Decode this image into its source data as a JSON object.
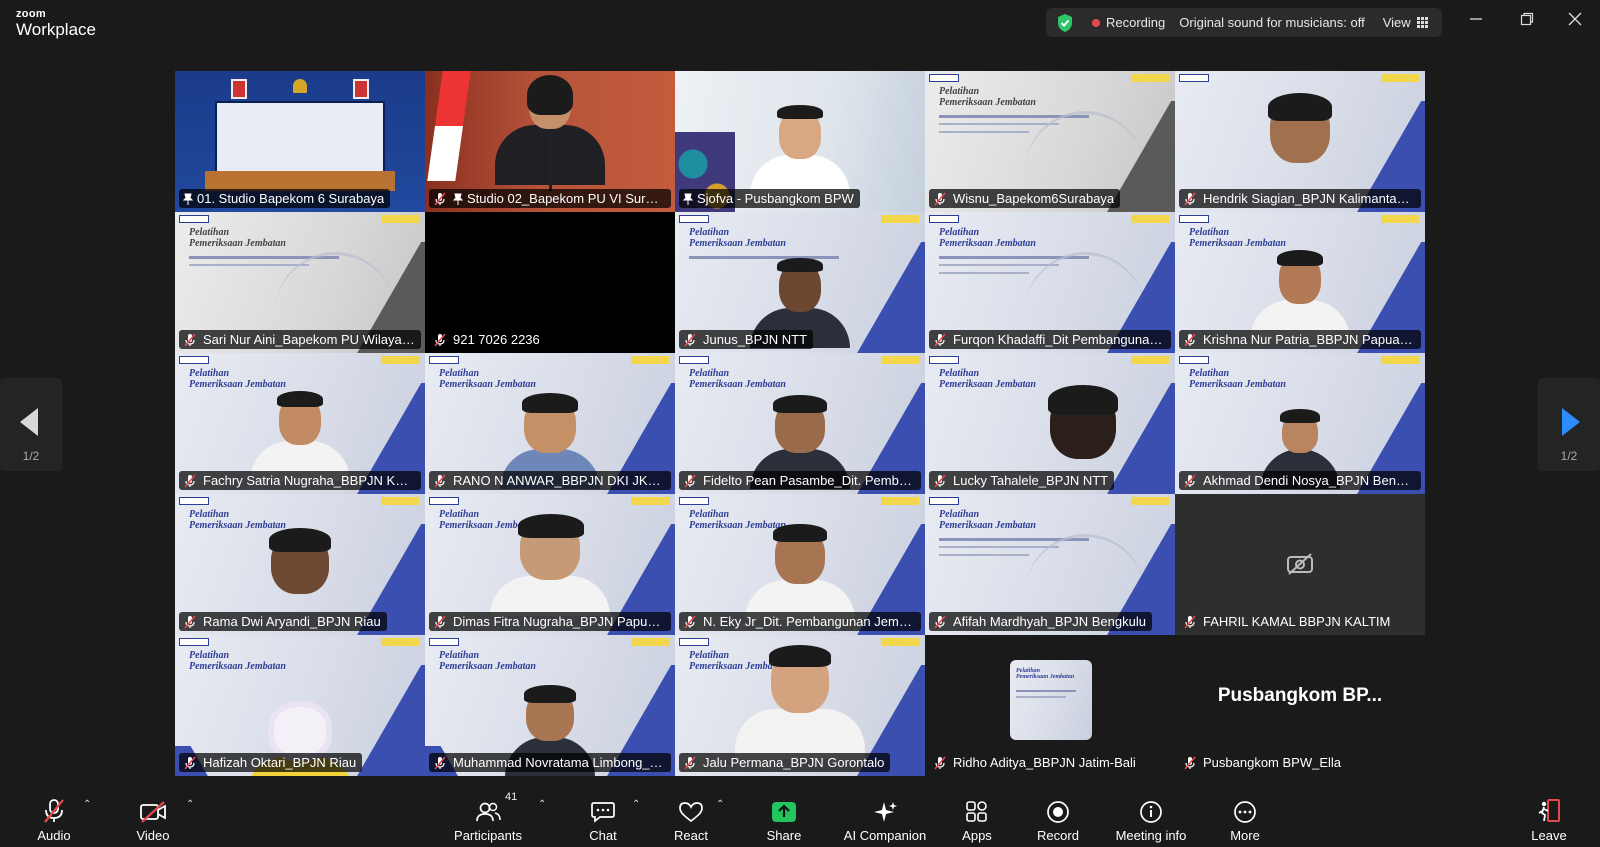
{
  "app": {
    "logo_top": "zoom",
    "logo_bottom": "Workplace"
  },
  "status": {
    "recording_label": "Recording",
    "original_sound": "Original sound for musicians: off",
    "view_label": "View"
  },
  "pager": {
    "left_page": "1/2",
    "right_page": "1/2"
  },
  "tiles": [
    {
      "name": "01. Studio Bapekom 6 Surabaya"
    },
    {
      "name": "Studio 02_Bapekom PU VI Suraba..."
    },
    {
      "name": "Sjofva - Pusbangkom BPW"
    },
    {
      "name": "Wisnu_Bapekom6Surabaya"
    },
    {
      "name": "Hendrik Siagian_BPJN Kalimantan Ba..."
    },
    {
      "name": "Sari Nur Aini_Bapekom PU Wilayah V..."
    },
    {
      "name": "921 7026 2236"
    },
    {
      "name": "Junus_BPJN NTT"
    },
    {
      "name": "Furqon Khadaffi_Dit Pembangunan J..."
    },
    {
      "name": "Krishna Nur Patria_BBPJN Papua Bara..."
    },
    {
      "name": "Fachry Satria Nugraha_BBPJN Kaltim"
    },
    {
      "name": "RANO N ANWAR_BBPJN DKI JKT-JAB..."
    },
    {
      "name": "Fidelto Pean Pasambe_Dit. Pembangu..."
    },
    {
      "name": "Lucky  Tahalele_BPJN NTT"
    },
    {
      "name": "Akhmad Dendi Nosya_BPJN Bengkulu"
    },
    {
      "name": "Rama Dwi Aryandi_BPJN Riau"
    },
    {
      "name": "Dimas Fitra Nugraha_BPJN Papua Sel..."
    },
    {
      "name": "N. Eky Jr_Dit. Pembangunan Jembatan"
    },
    {
      "name": "Afifah Mardhyah_BPJN Bengkulu"
    },
    {
      "name": "FAHRIL KAMAL BBPJN KALTIM"
    },
    {
      "name": "Hafizah Oktari_BPJN Riau"
    },
    {
      "name": "Muhammad Novratama Limbong_BP..."
    },
    {
      "name": "Jalu Permana_BPJN Gorontalo"
    },
    {
      "name": "Ridho Aditya_BBPJN Jatim-Bali"
    },
    {
      "name": "Pusbangkom BPW_Ella",
      "big_label": "Pusbangkom  BP..."
    }
  ],
  "slide": {
    "title_line1": "Pelatihan",
    "title_line2": "Pemeriksaan Jembatan"
  },
  "toolbar": {
    "audio": "Audio",
    "video": "Video",
    "participants": "Participants",
    "participant_count": "41",
    "chat": "Chat",
    "react": "React",
    "share": "Share",
    "ai_companion": "AI Companion",
    "apps": "Apps",
    "record": "Record",
    "meeting_info": "Meeting info",
    "more": "More",
    "leave": "Leave"
  },
  "colors": {
    "active_speaker": "#2fd46b",
    "share_green": "#22c55e",
    "accent_blue": "#2d8cff",
    "leave_red": "#e5484d"
  }
}
